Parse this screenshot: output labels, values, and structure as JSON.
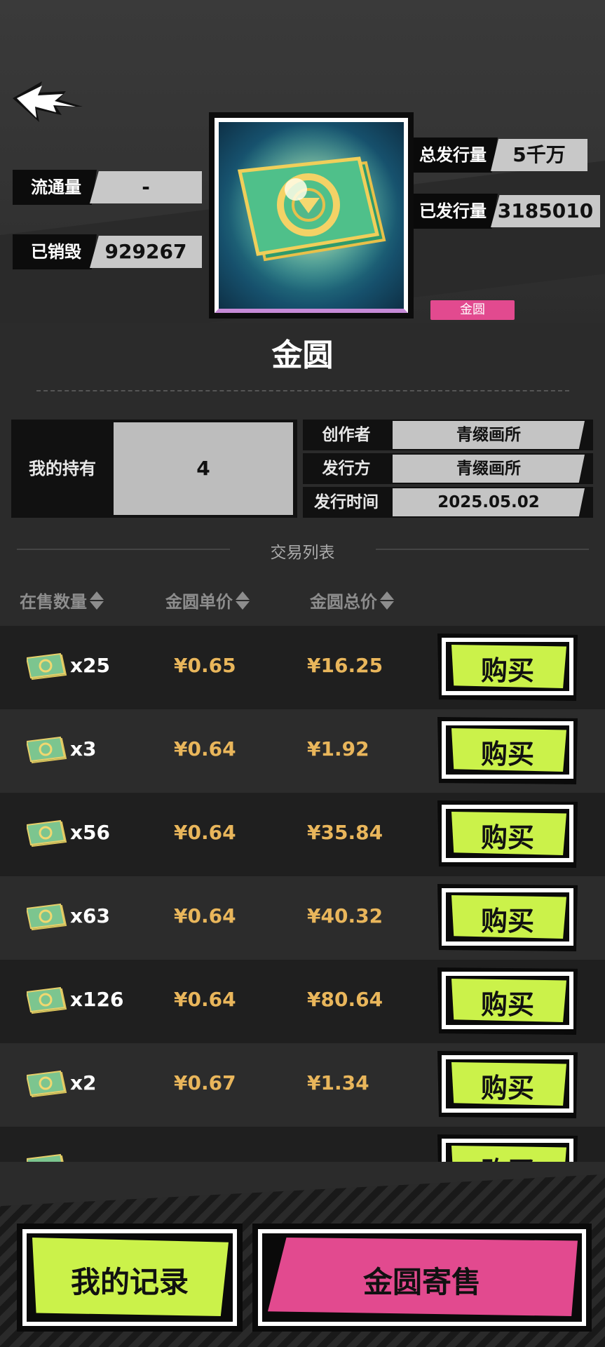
{
  "item": {
    "name": "金圆",
    "tag": "金圆"
  },
  "stats": {
    "circulation": {
      "label": "流通量",
      "value": "-"
    },
    "destroyed": {
      "label": "已销毁",
      "value": "929267"
    },
    "total_issue": {
      "label": "总发行量",
      "value": "5千万"
    },
    "issued": {
      "label": "已发行量",
      "value": "3185010"
    }
  },
  "holding": {
    "label": "我的持有",
    "value": "4"
  },
  "info": [
    {
      "label": "创作者",
      "value": "青缀画所"
    },
    {
      "label": "发行方",
      "value": "青缀画所"
    },
    {
      "label": "发行时间",
      "value": "2025.05.02"
    }
  ],
  "trade_section_title": "交易列表",
  "columns": {
    "qty": "在售数量",
    "unit": "金圆单价",
    "total": "金圆总价"
  },
  "listings": [
    {
      "qty": "x25",
      "unit": "¥0.65",
      "total": "¥16.25",
      "buy": "购买"
    },
    {
      "qty": "x3",
      "unit": "¥0.64",
      "total": "¥1.92",
      "buy": "购买"
    },
    {
      "qty": "x56",
      "unit": "¥0.64",
      "total": "¥35.84",
      "buy": "购买"
    },
    {
      "qty": "x63",
      "unit": "¥0.64",
      "total": "¥40.32",
      "buy": "购买"
    },
    {
      "qty": "x126",
      "unit": "¥0.64",
      "total": "¥80.64",
      "buy": "购买"
    },
    {
      "qty": "x2",
      "unit": "¥0.67",
      "total": "¥1.34",
      "buy": "购买"
    }
  ],
  "partial_row": {
    "buy": "购买"
  },
  "bottom": {
    "records": "我的记录",
    "consign": "金圆寄售"
  },
  "colors": {
    "accent_lime": "#cbf24a",
    "accent_pink": "#e24a8f",
    "price_gold": "#e9b65b"
  }
}
